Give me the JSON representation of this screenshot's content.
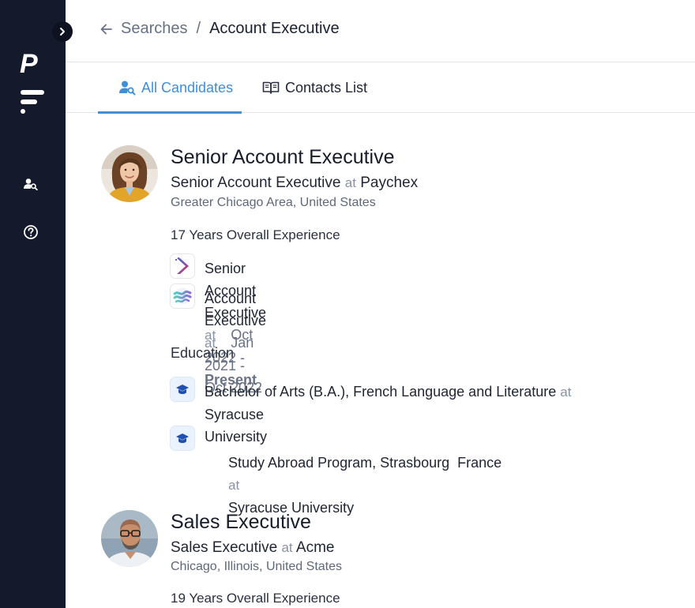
{
  "sidebar": {
    "logo_letter": "P",
    "items": [
      {
        "icon": "user-search-icon"
      },
      {
        "icon": "help-circle-icon"
      }
    ],
    "toggle_icon": "chevron-right-icon"
  },
  "breadcrumb": {
    "back_icon": "arrow-left-icon",
    "parent": "Searches",
    "separator": "/",
    "current": "Account Executive"
  },
  "tabs": [
    {
      "label": "All Candidates",
      "icon": "user-search-icon",
      "active": true
    },
    {
      "label": "Contacts List",
      "icon": "open-book-icon",
      "active": false
    }
  ],
  "candidates": [
    {
      "name": "Senior Account Executive",
      "title": "Senior Account Executive",
      "at": "at",
      "company": "Paychex",
      "location": "Greater Chicago Area, United States",
      "overall_experience": "17 Years Overall Experience",
      "experience": [
        {
          "role": "Senior Account Executive",
          "at": "at",
          "dates": "Oct 2022 - ",
          "present": "Present",
          "logo": "chevron-logo-icon"
        },
        {
          "role": "Account Executive",
          "at": "at",
          "dates": "Jan 2021 - Oct 2022",
          "logo": "wave-logo-icon"
        }
      ],
      "education_heading": "Education",
      "education": [
        {
          "degree": "Bachelor of Arts (B.A.), French Language and Literature",
          "at": "at",
          "school_line1": "Syracuse",
          "school_line2": "University",
          "icon": "graduation-cap-icon"
        },
        {
          "degree": "Study Abroad Program, Strasbourg  France",
          "at": "at",
          "school": "Syracuse University",
          "icon": "graduation-cap-icon"
        }
      ]
    },
    {
      "name": "Sales Executive",
      "title": "Sales Executive",
      "at": "at",
      "company": "Acme",
      "location": "Chicago, Illinois, United States",
      "overall_experience": "19 Years Overall Experience"
    }
  ],
  "colors": {
    "sidebar_bg": "#141a2b",
    "accent": "#3f8ed8",
    "muted_text": "#677184"
  }
}
